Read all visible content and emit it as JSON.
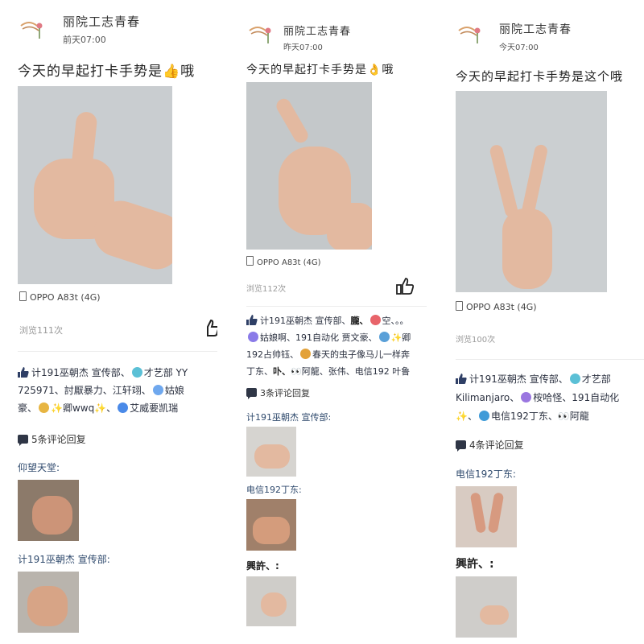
{
  "colors": {
    "link_blue": "#2f4a6d",
    "photo_bg": "#c9cdd0",
    "skin": "#e3b9a0",
    "divider": "#ececec"
  },
  "posts": [
    {
      "username": "丽院工志青春",
      "time": "前天07:00",
      "text": "今天的早起打卡手势是👍哦",
      "device": "OPPO A83t (4G)",
      "views": "浏览111次",
      "likes_lines": [
        "计191巫朝杰 宣传部、",
        "才艺部 YY",
        "725971、討厭暴力、江轩翊、",
        "姑娘",
        "豪、",
        "✨卿wwq✨、",
        "艾威要凯瑞"
      ],
      "comment_count": "5条评论回复",
      "comments": [
        "仰望天堂:",
        "计191巫朝杰 宣传部:"
      ]
    },
    {
      "username": "丽院工志青春",
      "time": "昨天07:00",
      "text": "今天的早起打卡手势是👌哦",
      "device": "OPPO A83t (4G)",
      "views": "浏览112次",
      "likes_lines": [
        "计191巫朝杰 宣传部、",
        "朧、",
        "空、。。",
        "姑娘啊、191自动化 贾文豪、",
        "✨卿",
        "192占帅钰、",
        "春天的虫子像马儿一样奔",
        "丁东、",
        "卟、",
        "👀阿龍、张伟、电信192 叶鲁"
      ],
      "comment_count": "3条评论回复",
      "comments": [
        "计191巫朝杰 宣传部:",
        "电信192丁东:",
        "興許、:"
      ]
    },
    {
      "username": "丽院工志青春",
      "time": "今天07:00",
      "text": "今天的早起打卡手势是这个哦",
      "device": "OPPO A83t (4G)",
      "views": "浏览100次",
      "likes_lines": [
        "计191巫朝杰 宣传部、",
        "才艺部",
        "Kilimanjaro、",
        "桉哈怪、191自动化",
        "✨、",
        "电信192丁东、👀阿龍"
      ],
      "comment_count": "4条评论回复",
      "comments": [
        "电信192丁东:",
        "興許、:"
      ]
    }
  ]
}
